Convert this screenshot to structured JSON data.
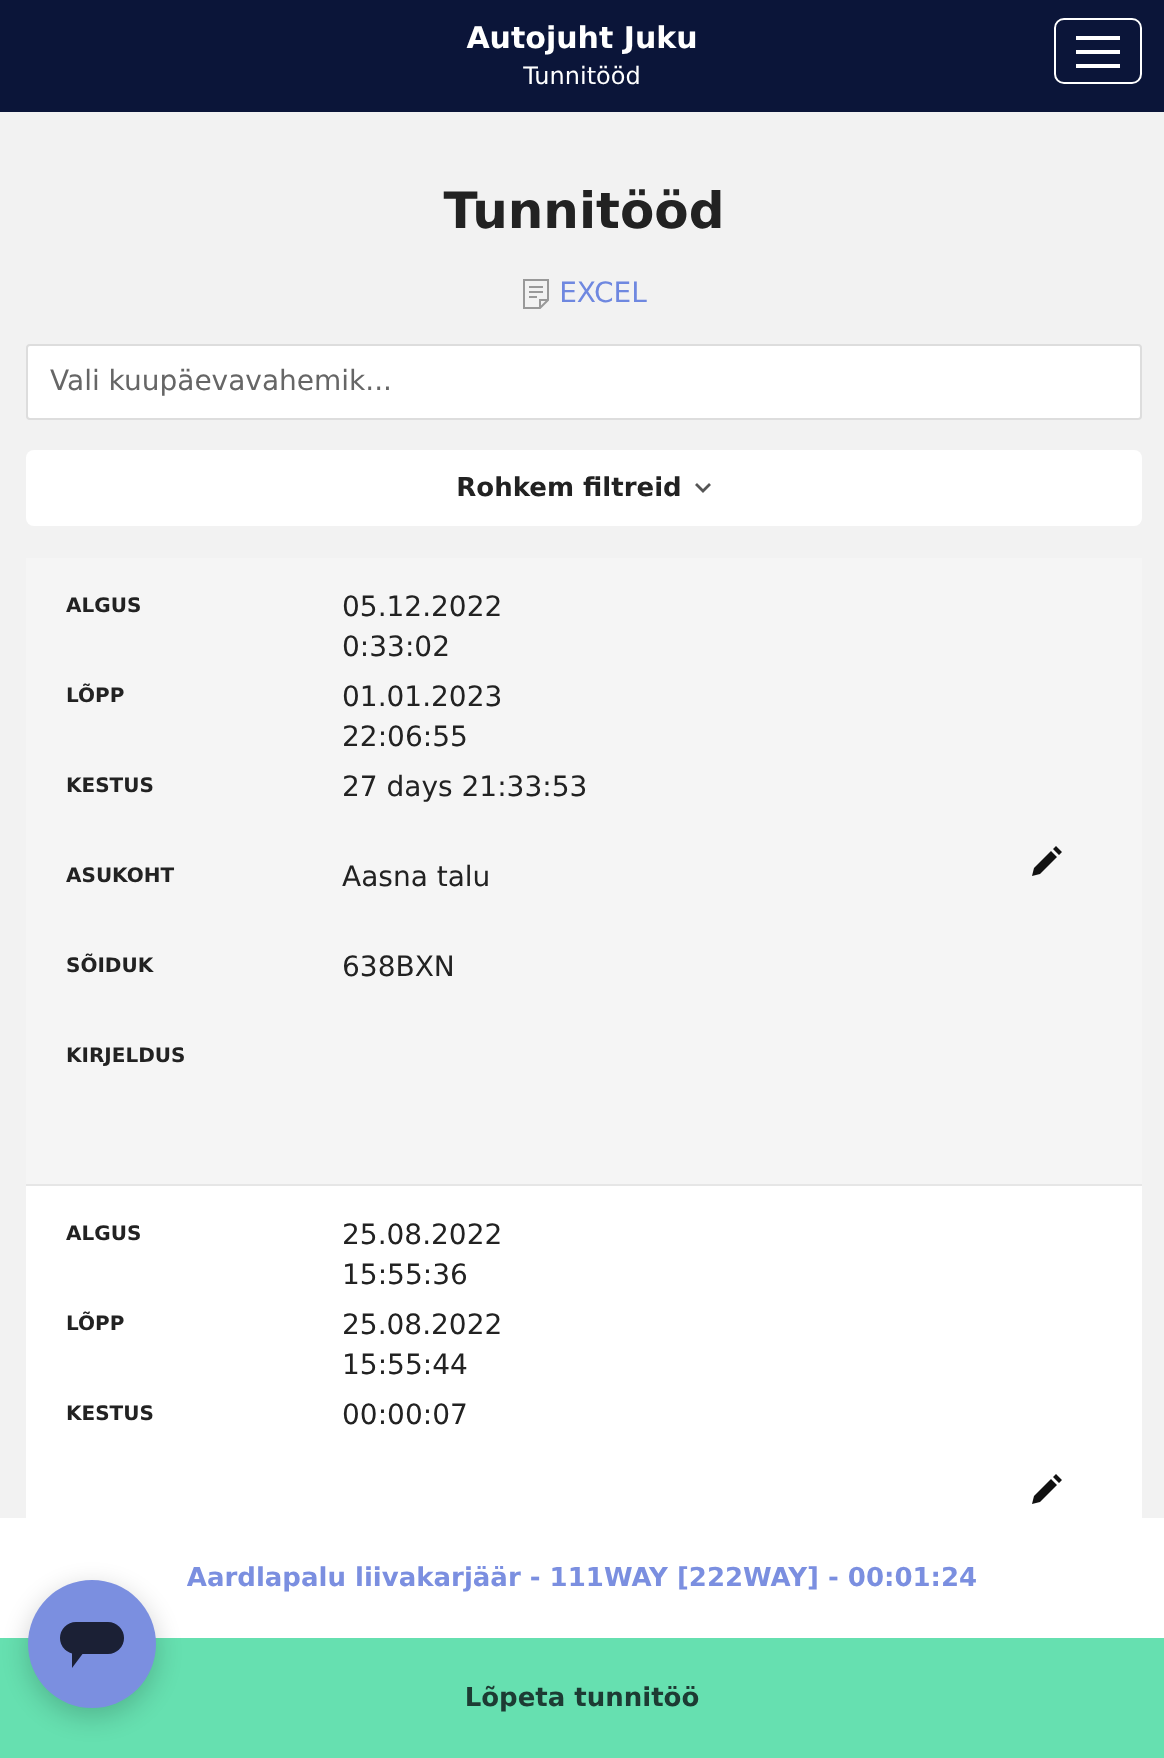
{
  "header": {
    "title": "Autojuht Juku",
    "subtitle": "Tunnitööd"
  },
  "page_title": "Tunnitööd",
  "export_link": "EXCEL",
  "date_range": {
    "placeholder": "Vali kuupäevavahemik..."
  },
  "filters_button": "Rohkem filtreid",
  "records": [
    {
      "highlighted": true,
      "fields": [
        {
          "label": "ALGUS",
          "lines": [
            "05.12.2022",
            "0:33:02"
          ]
        },
        {
          "label": "LÕPP",
          "lines": [
            "01.01.2023",
            "22:06:55"
          ]
        },
        {
          "label": "KESTUS",
          "lines": [
            "27 days 21:33:53"
          ]
        },
        {
          "label": "ASUKOHT",
          "lines": [
            "Aasna talu"
          ]
        },
        {
          "label": "SÕIDUK",
          "lines": [
            "638BXN"
          ]
        },
        {
          "label": "KIRJELDUS"
        }
      ]
    },
    {
      "highlighted": false,
      "fields": [
        {
          "label": "ALGUS",
          "lines": [
            "25.08.2022",
            "15:55:36"
          ]
        },
        {
          "label": "LÕPP",
          "lines": [
            "25.08.2022",
            "15:55:44"
          ]
        },
        {
          "label": "KESTUS",
          "lines": [
            "00:00:07"
          ]
        }
      ]
    }
  ],
  "active_job": "Aardlapalu liivakarjäär - 111WAY [222WAY] - 00:01:24",
  "stop_button": "Lõpeta tunnitöö"
}
